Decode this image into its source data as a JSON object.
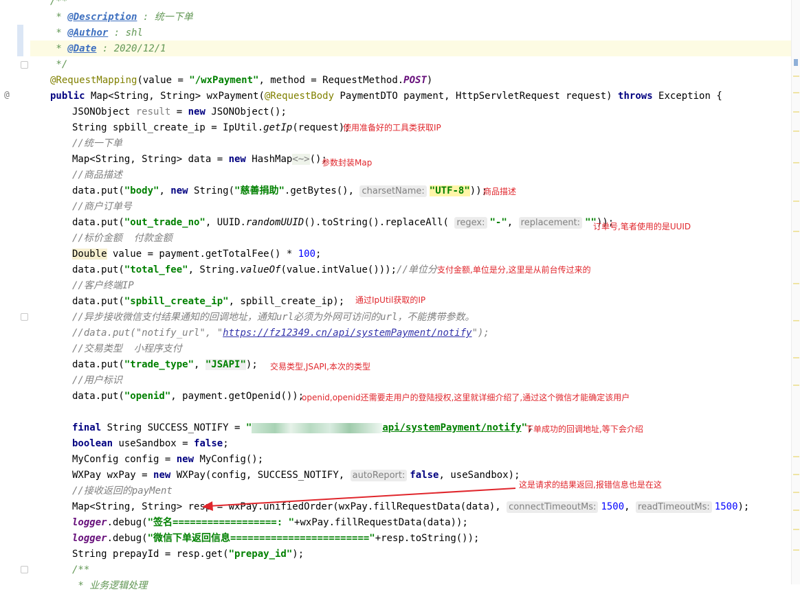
{
  "gutter": {
    "override_marker": "@"
  },
  "code": {
    "line0": "/**",
    "line1_star": " * ",
    "line1_tag": "@Description",
    "line1_text": " : 统一下单",
    "line2_star": " * ",
    "line2_tag": "@Author",
    "line2_text": " : shl",
    "line3_star": " * ",
    "line3_tag": "@Date",
    "line3_text": " : 2020/12/1",
    "line4": " */",
    "line5_anno": "@RequestMapping",
    "line5_a": "(value = ",
    "line5_str": "\"/wxPayment\"",
    "line5_b": ", method = RequestMethod.",
    "line5_c": "POST",
    "line5_d": ")",
    "line6_kw": "public",
    "line6_a": " Map<String, String> wxPayment(",
    "line6_anno": "@RequestBody",
    "line6_b": " PaymentDTO payment, HttpServletRequest request) ",
    "line6_kw2": "throws",
    "line6_c": " Exception {",
    "line7_a": "JSONObject ",
    "line7_b": "result",
    "line7_c": " = ",
    "line7_kw": "new",
    "line7_d": " JSONObject();",
    "line8_a": "String spbill_create_ip = IpUtil.",
    "line8_b": "getIp",
    "line8_c": "(request);",
    "line9": "//统一下单",
    "line10_a": "Map<String, String> data = ",
    "line10_kw": "new",
    "line10_b": " HashMap",
    "line10_c": "<~>",
    "line10_d": "();",
    "line11": "//商品描述",
    "line12_a": "data.put(",
    "line12_s1": "\"body\"",
    "line12_b": ", ",
    "line12_kw": "new",
    "line12_c": " String(",
    "line12_s2": "\"慈善捐助\"",
    "line12_d": ".getBytes(), ",
    "line12_hint": "charsetName:",
    "line12_s3": "\"UTF-8\"",
    "line12_e": "));",
    "line13": "//商户订单号",
    "line14_a": "data.put(",
    "line14_s1": "\"out_trade_no\"",
    "line14_b": ", UUID.",
    "line14_c": "randomUUID",
    "line14_d": "().toString().replaceAll( ",
    "line14_hint1": "regex:",
    "line14_s2": "\"-\"",
    "line14_e": ", ",
    "line14_hint2": "replacement:",
    "line14_s3": "\"\"",
    "line14_f": "));",
    "line15": "//标价金额  付款金额",
    "line16_a": "Double",
    "line16_b": " value = payment.getTotalFee() * ",
    "line16_num": "100",
    "line16_c": ";",
    "line17_a": "data.put(",
    "line17_s1": "\"total_fee\"",
    "line17_b": ", String.",
    "line17_c": "valueOf",
    "line17_d": "(value.intValue()));",
    "line17_com": "//单位分",
    "line18": "//客户终端IP",
    "line19_a": "data.put(",
    "line19_s1": "\"spbill_create_ip\"",
    "line19_b": ", spbill_create_ip);",
    "line20": "//异步接收微信支付结果通知的回调地址，通知url必须为外网可访问的url，不能携带参数。",
    "line21_a": "//data.put(\"notify_url\", \"",
    "line21_link": "https://fz12349.cn/api/systemPayment/notify",
    "line21_b": "\");",
    "line22": "//交易类型  小程序支付",
    "line23_a": "data.put(",
    "line23_s1": "\"trade_type\"",
    "line23_b": ", ",
    "line23_s2": "\"JSAPI\"",
    "line23_c": ");",
    "line24": "//用户标识",
    "line25_a": "data.put(",
    "line25_s1": "\"openid\"",
    "line25_b": ", payment.getOpenid());",
    "line27_kw": "final",
    "line27_a": " String SUCCESS_NOTIFY = ",
    "line27_s1": "\"",
    "line27_s2": "api/systemPayment/notify",
    "line27_s3": "\"",
    "line27_b": ";",
    "line28_kw": "boolean",
    "line28_a": " useSandbox = ",
    "line28_kw2": "false",
    "line28_b": ";",
    "line29_a": "MyConfig config = ",
    "line29_kw": "new",
    "line29_b": " MyConfig();",
    "line30_a": "WXPay wxPay = ",
    "line30_kw": "new",
    "line30_b": " WXPay(config, SUCCESS_NOTIFY, ",
    "line30_hint": "autoReport:",
    "line30_kw2": "false",
    "line30_c": ", useSandbox);",
    "line31_a": "//接收返回的",
    "line31_b": "payMent",
    "line32_a": "Map<String, String> resp = wxPay.unifiedOrder(wxPay.fillRequestData(data), ",
    "line32_hint1": "connectTimeoutMs:",
    "line32_num1": "1500",
    "line32_b": ", ",
    "line32_hint2": "readTimeoutMs:",
    "line32_num2": "1500",
    "line32_c": ");",
    "line33_a": "logger",
    "line33_b": ".debug(",
    "line33_s": "\"签名==================: \"",
    "line33_c": "+wxPay.fillRequestData(data));",
    "line34_a": "logger",
    "line34_b": ".debug(",
    "line34_s": "\"微信下单返回信息========================\"",
    "line34_c": "+resp.toString());",
    "line35_a": "String prepayId = resp.get(",
    "line35_s": "\"prepay_id\"",
    "line35_b": ");",
    "line36": "/**",
    "line37": " * 业务逻辑处理"
  },
  "annotations": {
    "a1": "使用准备好的工具类获取IP",
    "a2": "参数封装Map",
    "a3": "商品描述",
    "a4": "订单号,笔者使用的是UUID",
    "a5": "支付金额,单位是分,这里是从前台传过来的",
    "a6": "通过IpUtil获取的IP",
    "a7": "交易类型,JSAPI,本次的类型",
    "a8": "openid,openid还需要走用户的登陆授权,这里就详细介绍了,通过这个微信才能确定该用户",
    "a9": "下单成功的回调地址,等下会介绍",
    "a10": "这是请求的结果返回,报错信息也是在这"
  },
  "colors": {
    "annotation": "#e0262c",
    "keyword": "#000080",
    "string": "#008000",
    "comment": "#808080"
  }
}
